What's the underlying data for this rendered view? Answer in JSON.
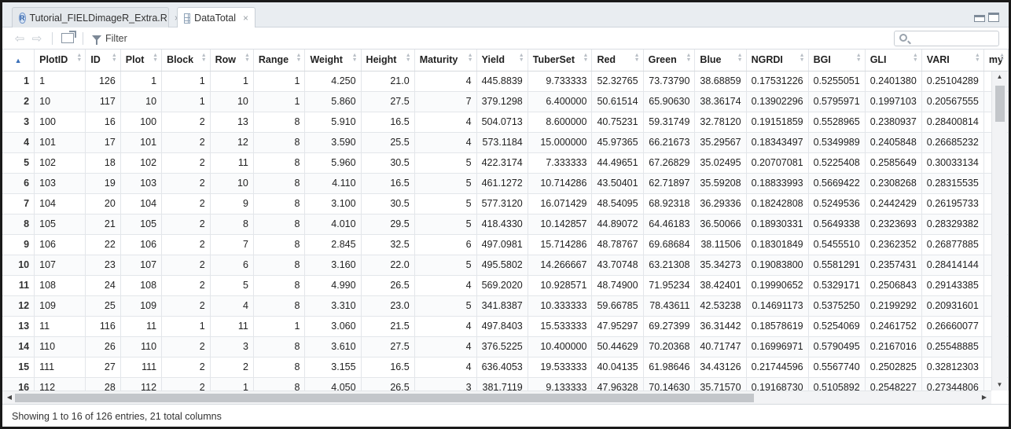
{
  "tabs": [
    {
      "label": "Tutorial_FIELDimageR_Extra.R",
      "close": "×"
    },
    {
      "label": "DataTotal",
      "close": "×"
    }
  ],
  "toolbar": {
    "back": "⇦",
    "forward": "⇨",
    "filter_label": "Filter",
    "search_value": ""
  },
  "columns": [
    "PlotID",
    "ID",
    "Plot",
    "Block",
    "Row",
    "Range",
    "Weight",
    "Height",
    "Maturity",
    "Yield",
    "TuberSet",
    "Red",
    "Green",
    "Blue",
    "NGRDI",
    "BGI",
    "GLI",
    "VARI",
    "my"
  ],
  "rows": [
    [
      "1",
      "1",
      "126",
      "1",
      "1",
      "1",
      "1",
      "4.250",
      "21.0",
      "4",
      "445.8839",
      "9.733333",
      "52.32765",
      "73.73790",
      "38.68859",
      "0.17531226",
      "0.5255051",
      "0.2401380",
      "0.25104289",
      ""
    ],
    [
      "2",
      "10",
      "117",
      "10",
      "1",
      "10",
      "1",
      "5.860",
      "27.5",
      "7",
      "379.1298",
      "6.400000",
      "50.61514",
      "65.90630",
      "38.36174",
      "0.13902296",
      "0.5795971",
      "0.1997103",
      "0.20567555",
      ""
    ],
    [
      "3",
      "100",
      "16",
      "100",
      "2",
      "13",
      "8",
      "5.910",
      "16.5",
      "4",
      "504.0713",
      "8.600000",
      "40.75231",
      "59.31749",
      "32.78120",
      "0.19151859",
      "0.5528965",
      "0.2380937",
      "0.28400814",
      ""
    ],
    [
      "4",
      "101",
      "17",
      "101",
      "2",
      "12",
      "8",
      "3.590",
      "25.5",
      "4",
      "573.1184",
      "15.000000",
      "45.97365",
      "66.21673",
      "35.29567",
      "0.18343497",
      "0.5349989",
      "0.2405848",
      "0.26685232",
      ""
    ],
    [
      "5",
      "102",
      "18",
      "102",
      "2",
      "11",
      "8",
      "5.960",
      "30.5",
      "5",
      "422.3174",
      "7.333333",
      "44.49651",
      "67.26829",
      "35.02495",
      "0.20707081",
      "0.5225408",
      "0.2585649",
      "0.30033134",
      ""
    ],
    [
      "6",
      "103",
      "19",
      "103",
      "2",
      "10",
      "8",
      "4.110",
      "16.5",
      "5",
      "461.1272",
      "10.714286",
      "43.50401",
      "62.71897",
      "35.59208",
      "0.18833993",
      "0.5669422",
      "0.2308268",
      "0.28315535",
      ""
    ],
    [
      "7",
      "104",
      "20",
      "104",
      "2",
      "9",
      "8",
      "3.100",
      "30.5",
      "5",
      "577.3120",
      "16.071429",
      "48.54095",
      "68.92318",
      "36.29336",
      "0.18242808",
      "0.5249536",
      "0.2442429",
      "0.26195733",
      ""
    ],
    [
      "8",
      "105",
      "21",
      "105",
      "2",
      "8",
      "8",
      "4.010",
      "29.5",
      "5",
      "418.4330",
      "10.142857",
      "44.89072",
      "64.46183",
      "36.50066",
      "0.18930331",
      "0.5649338",
      "0.2323693",
      "0.28329382",
      ""
    ],
    [
      "9",
      "106",
      "22",
      "106",
      "2",
      "7",
      "8",
      "2.845",
      "32.5",
      "6",
      "497.0981",
      "15.714286",
      "48.78767",
      "69.68684",
      "38.11506",
      "0.18301849",
      "0.5455510",
      "0.2362352",
      "0.26877885",
      ""
    ],
    [
      "10",
      "107",
      "23",
      "107",
      "2",
      "6",
      "8",
      "3.160",
      "22.0",
      "5",
      "495.5802",
      "14.266667",
      "43.70748",
      "63.21308",
      "35.34273",
      "0.19083800",
      "0.5581291",
      "0.2357431",
      "0.28414144",
      ""
    ],
    [
      "11",
      "108",
      "24",
      "108",
      "2",
      "5",
      "8",
      "4.990",
      "26.5",
      "4",
      "569.2020",
      "10.928571",
      "48.74900",
      "71.95234",
      "38.42401",
      "0.19990652",
      "0.5329171",
      "0.2506843",
      "0.29143385",
      ""
    ],
    [
      "12",
      "109",
      "25",
      "109",
      "2",
      "4",
      "8",
      "3.310",
      "23.0",
      "5",
      "341.8387",
      "10.333333",
      "59.66785",
      "78.43611",
      "42.53238",
      "0.14691173",
      "0.5375250",
      "0.2199292",
      "0.20931601",
      ""
    ],
    [
      "13",
      "11",
      "116",
      "11",
      "1",
      "11",
      "1",
      "3.060",
      "21.5",
      "4",
      "497.8403",
      "15.533333",
      "47.95297",
      "69.27399",
      "36.31442",
      "0.18578619",
      "0.5254069",
      "0.2461752",
      "0.26660077",
      ""
    ],
    [
      "14",
      "110",
      "26",
      "110",
      "2",
      "3",
      "8",
      "3.610",
      "27.5",
      "4",
      "376.5225",
      "10.400000",
      "50.44629",
      "70.20368",
      "40.71747",
      "0.16996971",
      "0.5790495",
      "0.2167016",
      "0.25548885",
      ""
    ],
    [
      "15",
      "111",
      "27",
      "111",
      "2",
      "2",
      "8",
      "3.155",
      "16.5",
      "4",
      "636.4053",
      "19.533333",
      "40.04135",
      "61.98646",
      "34.43126",
      "0.21744596",
      "0.5567740",
      "0.2502825",
      "0.32812303",
      ""
    ],
    [
      "16",
      "112",
      "28",
      "112",
      "2",
      "1",
      "8",
      "4.050",
      "26.5",
      "3",
      "381.7119",
      "9.133333",
      "47.96328",
      "70.14630",
      "35.71570",
      "0.19168730",
      "0.5105892",
      "0.2548227",
      "0.27344806",
      ""
    ]
  ],
  "status": "Showing 1 to 16 of 126 entries, 21 total columns",
  "icons": {
    "tab1": "r-script-icon",
    "tab2": "table-icon",
    "search": "search-icon",
    "filter": "funnel-icon"
  },
  "colors": {
    "accent": "#3a6fb8",
    "header_bg": "#e9edf1",
    "scroll_thumb": "#c3c6ca"
  }
}
